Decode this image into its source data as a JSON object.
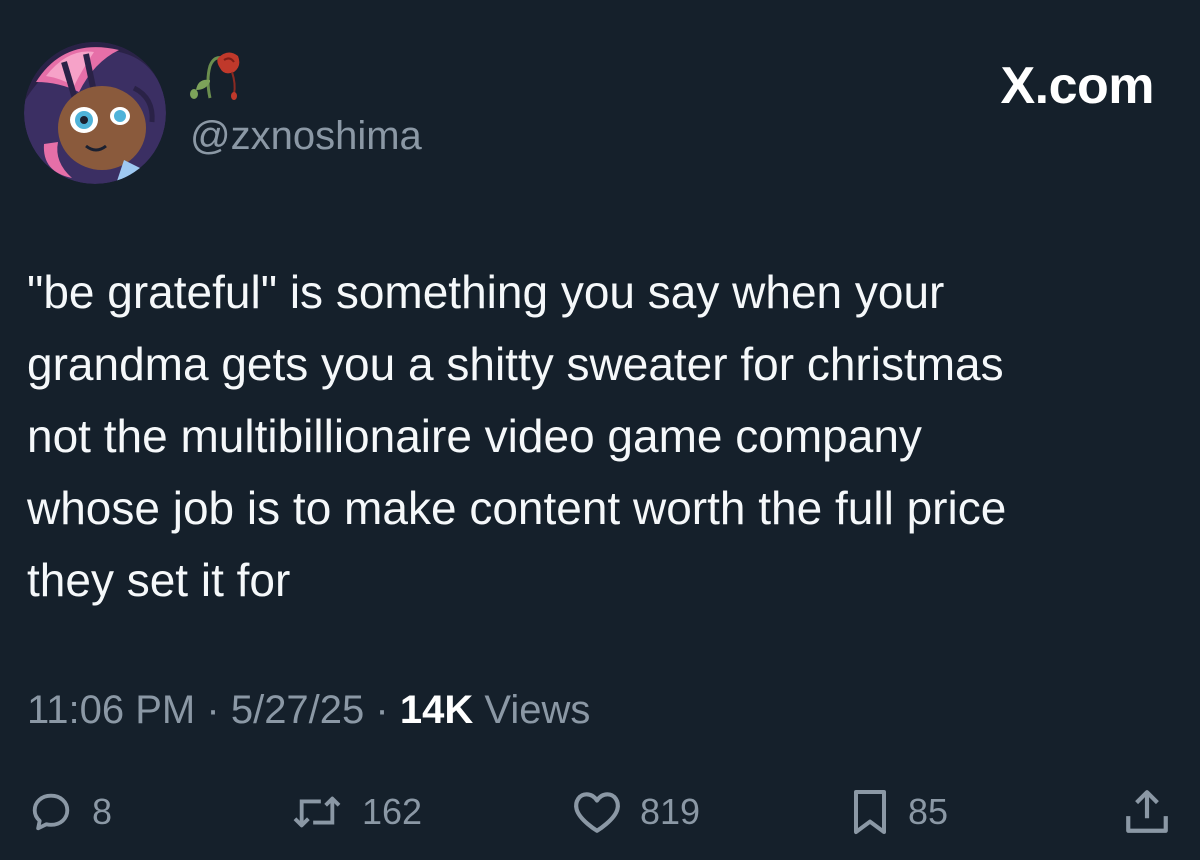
{
  "site": {
    "label": "X.com"
  },
  "author": {
    "handle": "@zxnoshima"
  },
  "tweet": {
    "lines": [
      "\"be grateful\" is something you say when your",
      "grandma gets you a shitty sweater for christmas",
      "not the multibillionaire video game company",
      "whose job is to make content worth the full price",
      "they set it for"
    ]
  },
  "meta": {
    "time": "11:06 PM",
    "separator": "·",
    "date": "5/27/25",
    "views_count": "14K",
    "views_label": "Views"
  },
  "actions": {
    "replies": "8",
    "reposts": "162",
    "likes": "819",
    "bookmarks": "85"
  },
  "icons": {
    "avatar": "avatar-image",
    "name_emoji": "wilted-rose-icon",
    "reply": "reply-icon",
    "repost": "repost-icon",
    "like": "heart-icon",
    "bookmark": "bookmark-icon",
    "share": "share-icon"
  },
  "colors": {
    "background": "#15202b",
    "text": "#f5f8fa",
    "secondary_text": "#8b98a5",
    "emphasis": "#ffffff"
  }
}
